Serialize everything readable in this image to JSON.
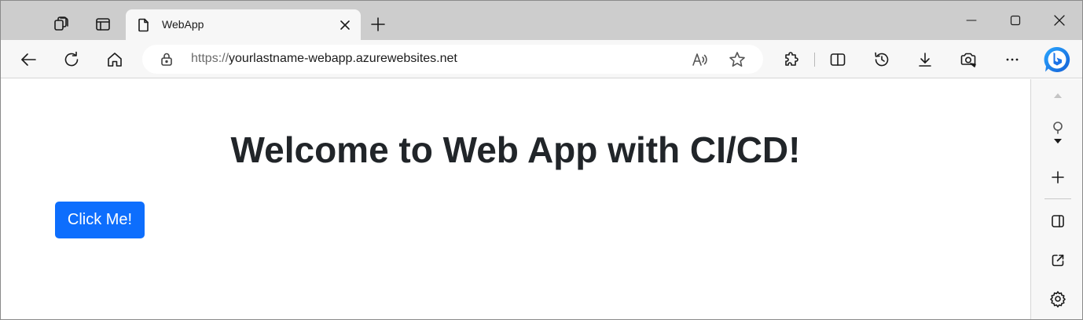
{
  "tab": {
    "title": "WebApp"
  },
  "address": {
    "scheme": "https://",
    "host": "yourlastname-webapp.azurewebsites.net"
  },
  "page": {
    "heading": "Welcome to Web App with CI/CD!",
    "button_label": "Click Me!"
  },
  "colors": {
    "accent": "#0d6efd",
    "heading": "#212529",
    "tabstrip": "#cdcdcd",
    "toolbar": "#f7f7f7"
  },
  "icons": {
    "tabstrip": [
      "workspaces-icon",
      "tab-actions-icon",
      "document-icon",
      "close-icon",
      "new-tab-icon"
    ],
    "window": [
      "minimize-icon",
      "maximize-icon",
      "window-close-icon"
    ],
    "toolbar": [
      "back-icon",
      "refresh-icon",
      "home-icon",
      "lock-icon",
      "read-aloud-icon",
      "favorite-star-icon",
      "extensions-icon",
      "split-screen-icon",
      "history-icon",
      "downloads-icon",
      "performance-icon",
      "more-icon",
      "bing-copilot-icon"
    ],
    "sidebar": [
      "scroll-up-icon",
      "search-icon",
      "scroll-down-icon",
      "add-icon",
      "hide-sidebar-icon",
      "open-external-icon",
      "settings-gear-icon"
    ]
  }
}
